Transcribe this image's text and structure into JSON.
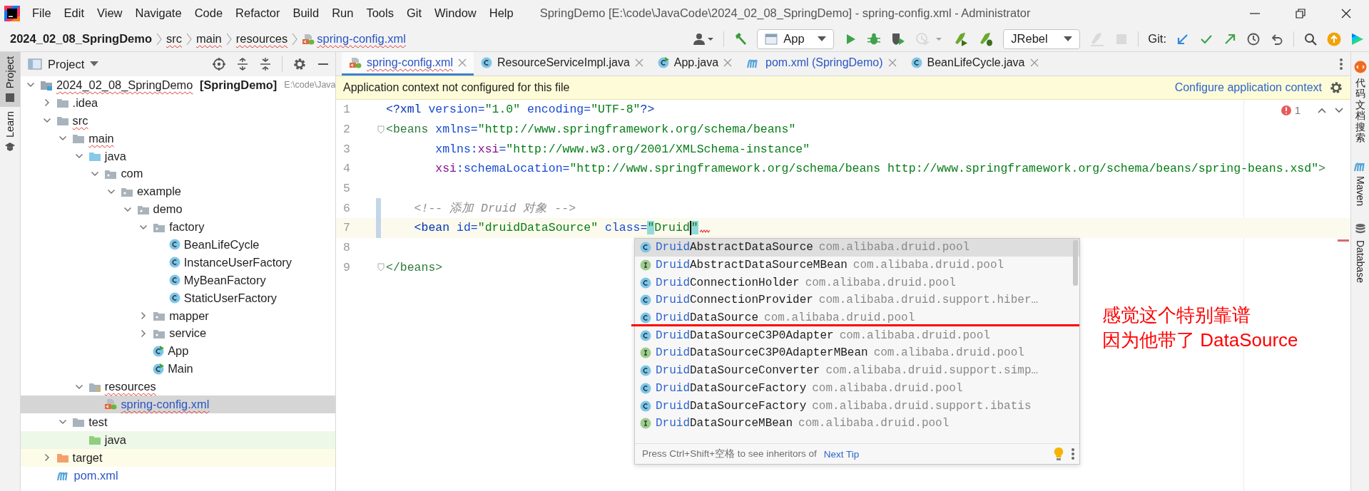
{
  "window": {
    "title": "SpringDemo [E:\\code\\JavaCode\\2024_02_08_SpringDemo] - spring-config.xml - Administrator"
  },
  "menu": [
    {
      "label": "File"
    },
    {
      "label": "Edit"
    },
    {
      "label": "View"
    },
    {
      "label": "Navigate"
    },
    {
      "label": "Code"
    },
    {
      "label": "Refactor"
    },
    {
      "label": "Build"
    },
    {
      "label": "Run"
    },
    {
      "label": "Tools"
    },
    {
      "label": "Git"
    },
    {
      "label": "Window"
    },
    {
      "label": "Help"
    }
  ],
  "breadcrumb": [
    {
      "label": "2024_02_08_SpringDemo",
      "kind": "project",
      "problem": false
    },
    {
      "label": "src",
      "kind": "folder",
      "problem": true
    },
    {
      "label": "main",
      "kind": "folder",
      "problem": true
    },
    {
      "label": "resources",
      "kind": "folder",
      "problem": true
    },
    {
      "label": "spring-config.xml",
      "kind": "xml",
      "problem": true
    }
  ],
  "toolbar": [
    {
      "kind": "user",
      "disabled": false
    },
    {
      "kind": "divider",
      "disabled": false
    },
    {
      "kind": "build",
      "disabled": false
    },
    {
      "kind": "config",
      "label": "App",
      "disabled": false
    },
    {
      "kind": "run",
      "disabled": false
    },
    {
      "kind": "debug",
      "disabled": false
    },
    {
      "kind": "coverage",
      "disabled": false
    },
    {
      "kind": "profile",
      "disabled": true
    },
    {
      "kind": "jrebel-run",
      "disabled": false
    },
    {
      "kind": "jrebel-debug",
      "disabled": false
    },
    {
      "kind": "config",
      "label": "JRebel",
      "disabled": false
    },
    {
      "kind": "jrebel-attach",
      "disabled": true
    },
    {
      "kind": "stop",
      "disabled": true
    },
    {
      "kind": "divider",
      "disabled": false
    },
    {
      "kind": "label",
      "label": "Git:",
      "disabled": false
    },
    {
      "kind": "update",
      "disabled": false
    },
    {
      "kind": "commit",
      "disabled": false
    },
    {
      "kind": "push",
      "disabled": false
    },
    {
      "kind": "history",
      "disabled": false
    },
    {
      "kind": "rollback",
      "disabled": false
    },
    {
      "kind": "divider",
      "disabled": false
    },
    {
      "kind": "search",
      "disabled": false
    },
    {
      "kind": "ide-update",
      "disabled": false
    },
    {
      "kind": "toolbox",
      "disabled": false
    }
  ],
  "left_tool_windows": [
    {
      "label": "Project",
      "selected": true
    },
    {
      "label": "Learn",
      "selected": false
    }
  ],
  "project_panel": {
    "title": "Project",
    "tree": [
      {
        "name": "2024_02_08_SpringDemo",
        "module": "[SpringDemo]",
        "path": "E:\\code\\Java",
        "kind": "module",
        "expanded": true,
        "selected": false,
        "modified": false,
        "problem": true,
        "children": [
          {
            "name": ".idea",
            "kind": "folder",
            "expanded": false,
            "selected": false,
            "modified": false,
            "problem": false
          },
          {
            "name": "src",
            "kind": "folder",
            "expanded": true,
            "selected": false,
            "modified": false,
            "problem": true,
            "children": [
              {
                "name": "main",
                "kind": "folder",
                "expanded": true,
                "selected": false,
                "modified": false,
                "problem": true,
                "children": [
                  {
                    "name": "java",
                    "kind": "source",
                    "expanded": true,
                    "selected": false,
                    "modified": false,
                    "problem": false,
                    "children": [
                      {
                        "name": "com",
                        "kind": "package",
                        "expanded": true,
                        "selected": false,
                        "modified": false,
                        "problem": false,
                        "children": [
                          {
                            "name": "example",
                            "kind": "package",
                            "expanded": true,
                            "selected": false,
                            "modified": false,
                            "problem": false,
                            "children": [
                              {
                                "name": "demo",
                                "kind": "package",
                                "expanded": true,
                                "selected": false,
                                "modified": false,
                                "problem": false,
                                "children": [
                                  {
                                    "name": "factory",
                                    "kind": "package",
                                    "expanded": true,
                                    "selected": false,
                                    "modified": false,
                                    "problem": false,
                                    "children": [
                                      {
                                        "name": "BeanLifeCycle",
                                        "kind": "class",
                                        "selected": false,
                                        "modified": false,
                                        "problem": false
                                      },
                                      {
                                        "name": "InstanceUserFactory",
                                        "kind": "class",
                                        "selected": false,
                                        "modified": false,
                                        "problem": false
                                      },
                                      {
                                        "name": "MyBeanFactory",
                                        "kind": "class",
                                        "selected": false,
                                        "modified": false,
                                        "problem": false
                                      },
                                      {
                                        "name": "StaticUserFactory",
                                        "kind": "class",
                                        "selected": false,
                                        "modified": false,
                                        "problem": false
                                      }
                                    ]
                                  },
                                  {
                                    "name": "mapper",
                                    "kind": "package",
                                    "expanded": false,
                                    "selected": false,
                                    "modified": false,
                                    "problem": false
                                  },
                                  {
                                    "name": "service",
                                    "kind": "package",
                                    "expanded": false,
                                    "selected": false,
                                    "modified": false,
                                    "problem": false
                                  },
                                  {
                                    "name": "App",
                                    "kind": "app",
                                    "selected": false,
                                    "modified": false,
                                    "problem": false
                                  },
                                  {
                                    "name": "Main",
                                    "kind": "app",
                                    "selected": false,
                                    "modified": false,
                                    "problem": false
                                  }
                                ]
                              }
                            ]
                          }
                        ]
                      }
                    ]
                  },
                  {
                    "name": "resources",
                    "kind": "resources",
                    "expanded": true,
                    "selected": false,
                    "modified": false,
                    "problem": true,
                    "children": [
                      {
                        "name": "spring-config.xml",
                        "kind": "xml",
                        "selected": true,
                        "modified": true,
                        "problem": true
                      }
                    ]
                  }
                ]
              },
              {
                "name": "test",
                "kind": "folder",
                "expanded": true,
                "selected": false,
                "modified": false,
                "problem": false,
                "children": [
                  {
                    "name": "java",
                    "kind": "test-source",
                    "selected": false,
                    "modified": false,
                    "problem": false
                  }
                ]
              }
            ]
          },
          {
            "name": "target",
            "kind": "excluded",
            "expanded": false,
            "selected": false,
            "modified": false,
            "problem": false
          },
          {
            "name": "pom.xml",
            "kind": "maven",
            "selected": false,
            "modified": true,
            "problem": false
          }
        ]
      }
    ]
  },
  "editor_tabs": [
    {
      "label": "spring-config.xml",
      "kind": "xml",
      "selected": true,
      "modified": true,
      "problem": true
    },
    {
      "label": "ResourceServiceImpl.java",
      "kind": "class",
      "selected": false,
      "modified": false,
      "problem": false
    },
    {
      "label": "App.java",
      "kind": "app",
      "selected": false,
      "modified": false,
      "problem": false
    },
    {
      "label": "pom.xml (SpringDemo)",
      "kind": "maven",
      "selected": false,
      "modified": true,
      "problem": false
    },
    {
      "label": "BeanLifeCycle.java",
      "kind": "class",
      "selected": false,
      "modified": false,
      "problem": false
    }
  ],
  "banner": {
    "message": "Application context not configured for this file",
    "action": "Configure application context"
  },
  "editor": {
    "problem_count": "1",
    "lines": [
      {
        "number": "1",
        "current": false,
        "changed": false,
        "fold": false,
        "error": false,
        "tokens": [
          {
            "kind": "tag",
            "text": "<?xml"
          },
          {
            "kind": "attr",
            "text": " version="
          },
          {
            "kind": "value",
            "text": "\"1.0\""
          },
          {
            "kind": "attr",
            "text": " encoding="
          },
          {
            "kind": "value",
            "text": "\"UTF-8\""
          },
          {
            "kind": "tag",
            "text": "?>"
          }
        ]
      },
      {
        "number": "2",
        "current": false,
        "changed": false,
        "fold": true,
        "error": false,
        "tokens": [
          {
            "kind": "matched-tag",
            "text": "<beans"
          },
          {
            "kind": "attr",
            "text": " xmlns="
          },
          {
            "kind": "value",
            "text": "\"http://www.springframework.org/schema/beans\""
          }
        ]
      },
      {
        "number": "3",
        "current": false,
        "changed": false,
        "fold": false,
        "error": false,
        "tokens": [
          {
            "kind": "attr",
            "text": "       xmlns:"
          },
          {
            "kind": "ns",
            "text": "xsi"
          },
          {
            "kind": "attr",
            "text": "="
          },
          {
            "kind": "value",
            "text": "\"http://www.w3.org/2001/XMLSchema-instance\""
          }
        ]
      },
      {
        "number": "4",
        "current": false,
        "changed": false,
        "fold": false,
        "error": false,
        "tokens": [
          {
            "kind": "ns",
            "text": "       xsi"
          },
          {
            "kind": "attr",
            "text": ":schemaLocation="
          },
          {
            "kind": "value",
            "text": "\"http://www.springframework.org/schema/beans http://www.springframework.org/schema/beans/spring-beans.xsd\""
          },
          {
            "kind": "matched-tag",
            "text": ">"
          }
        ]
      },
      {
        "number": "5",
        "current": false,
        "changed": false,
        "fold": false,
        "error": false
      },
      {
        "number": "6",
        "current": false,
        "changed": true,
        "fold": false,
        "error": false,
        "tokens": [
          {
            "kind": "comment",
            "text": "    <!-- 添加 Druid 对象 -->"
          }
        ]
      },
      {
        "number": "7",
        "current": true,
        "changed": true,
        "fold": false,
        "error": true,
        "tokens": [
          {
            "kind": "tag",
            "text": "    <bean"
          },
          {
            "kind": "attr",
            "text": " id="
          },
          {
            "kind": "value",
            "text": "\"druidDataSource\""
          },
          {
            "kind": "attr",
            "text": " class="
          },
          {
            "kind": "quote-match",
            "text": "\""
          },
          {
            "kind": "value",
            "text": "Druid"
          },
          {
            "kind": "caret"
          },
          {
            "kind": "quote-match",
            "text": "\""
          }
        ]
      },
      {
        "number": "8",
        "current": false,
        "changed": false,
        "fold": false,
        "error": false
      },
      {
        "number": "9",
        "current": false,
        "changed": false,
        "fold": true,
        "error": false,
        "tokens": [
          {
            "kind": "matched-tag",
            "text": "</beans>"
          }
        ]
      }
    ],
    "completion": {
      "items": [
        {
          "match": "Druid",
          "rest": "AbstractDataSource",
          "package": "com.alibaba.druid.pool",
          "kind": "class",
          "selected": true
        },
        {
          "match": "Druid",
          "rest": "AbstractDataSourceMBean",
          "package": "com.alibaba.druid.pool",
          "kind": "interface",
          "selected": false
        },
        {
          "match": "Druid",
          "rest": "ConnectionHolder",
          "package": "com.alibaba.druid.pool",
          "kind": "class",
          "selected": false
        },
        {
          "match": "Druid",
          "rest": "ConnectionProvider",
          "package": "com.alibaba.druid.support.hiber…",
          "kind": "class",
          "selected": false
        },
        {
          "match": "Druid",
          "rest": "DataSource",
          "package": "com.alibaba.druid.pool",
          "kind": "class",
          "selected": false
        },
        {
          "match": "Druid",
          "rest": "DataSourceC3P0Adapter",
          "package": "com.alibaba.druid.pool",
          "kind": "class",
          "selected": false
        },
        {
          "match": "Druid",
          "rest": "DataSourceC3P0AdapterMBean",
          "package": "com.alibaba.druid.pool",
          "kind": "interface",
          "selected": false
        },
        {
          "match": "Druid",
          "rest": "DataSourceConverter",
          "package": "com.alibaba.druid.support.simp…",
          "kind": "class",
          "selected": false
        },
        {
          "match": "Druid",
          "rest": "DataSourceFactory",
          "package": "com.alibaba.druid.pool",
          "kind": "class",
          "selected": false
        },
        {
          "match": "Druid",
          "rest": "DataSourceFactory",
          "package": "com.alibaba.druid.support.ibatis",
          "kind": "class",
          "selected": false
        },
        {
          "match": "Druid",
          "rest": "DataSourceMBean",
          "package": "com.alibaba.druid.pool",
          "kind": "interface",
          "selected": false
        }
      ],
      "hint": "Press Ctrl+Shift+空格 to see inheritors of",
      "tip_link": "Next Tip"
    },
    "annotation": {
      "lines": [
        "感觉这个特别靠谱",
        "因为他带了 DataSource"
      ]
    }
  },
  "right_tool_windows": [
    {
      "label": "代码文档搜索",
      "kind": "plugin"
    },
    {
      "label": "Maven",
      "kind": "maven"
    },
    {
      "label": "Database",
      "kind": "database"
    }
  ]
}
